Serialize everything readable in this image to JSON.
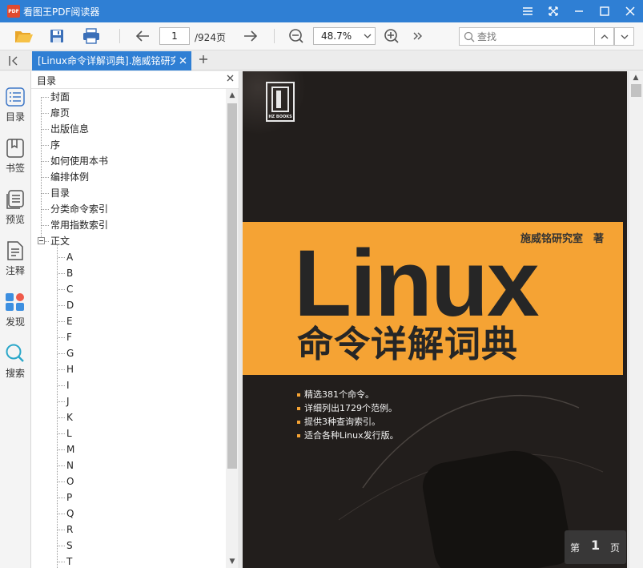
{
  "window": {
    "app_logo_text": "PDF",
    "title": "看图王PDF阅读器"
  },
  "toolbar": {
    "page_current": "1",
    "page_total": "/924页",
    "zoom": "48.7%",
    "search_placeholder": "查找"
  },
  "tabs": [
    {
      "label": "[Linux命令详解词典].施威铭研究室"
    }
  ],
  "rail": {
    "items": [
      {
        "label": "目录"
      },
      {
        "label": "书签"
      },
      {
        "label": "预览"
      },
      {
        "label": "注释"
      },
      {
        "label": "发现"
      },
      {
        "label": "搜索"
      }
    ]
  },
  "toc": {
    "title": "目录",
    "top_items": [
      "封面",
      "扉页",
      "出版信息",
      "序",
      "如何使用本书",
      "编排体例",
      "目录",
      "分类命令索引",
      "常用指数索引",
      "正文"
    ],
    "sub_items": [
      "A",
      "B",
      "C",
      "D",
      "E",
      "F",
      "G",
      "H",
      "I",
      "J",
      "K",
      "L",
      "M",
      "N",
      "O",
      "P",
      "Q",
      "R",
      "S",
      "T"
    ]
  },
  "cover": {
    "publisher_logo_text": "HZ BOOKS",
    "author": "施威铭研究室　著",
    "title_en": "Linux",
    "title_cn": "命令详解词典",
    "bullets": [
      "精选381个命令。",
      "详细列出1729个范例。",
      "提供3种查询索引。",
      "适合各种Linux发行版。"
    ]
  },
  "page_badge": {
    "prefix": "第",
    "number": "1",
    "suffix": "页"
  },
  "colors": {
    "accent": "#2f7fd4",
    "cover_band": "#f5a334",
    "cover_bg": "#221e1c"
  }
}
